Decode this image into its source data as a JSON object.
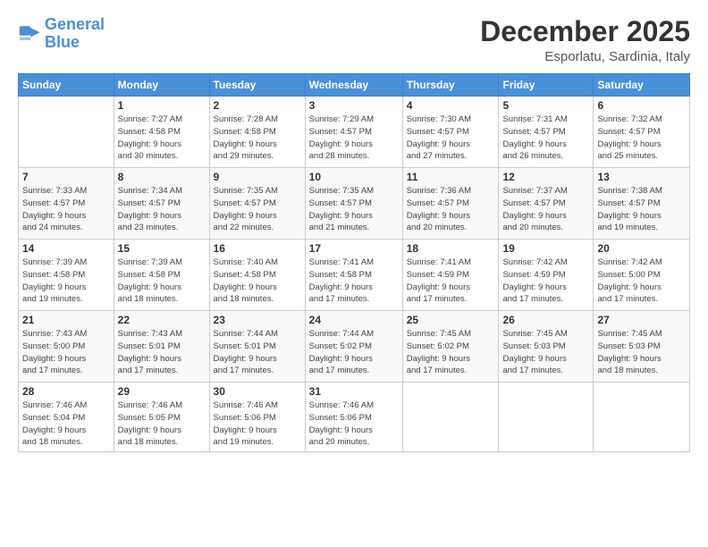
{
  "header": {
    "logo_line1": "General",
    "logo_line2": "Blue",
    "month": "December 2025",
    "location": "Esporlatu, Sardinia, Italy"
  },
  "weekdays": [
    "Sunday",
    "Monday",
    "Tuesday",
    "Wednesday",
    "Thursday",
    "Friday",
    "Saturday"
  ],
  "weeks": [
    [
      {
        "day": "",
        "info": ""
      },
      {
        "day": "1",
        "info": "Sunrise: 7:27 AM\nSunset: 4:58 PM\nDaylight: 9 hours\nand 30 minutes."
      },
      {
        "day": "2",
        "info": "Sunrise: 7:28 AM\nSunset: 4:58 PM\nDaylight: 9 hours\nand 29 minutes."
      },
      {
        "day": "3",
        "info": "Sunrise: 7:29 AM\nSunset: 4:57 PM\nDaylight: 9 hours\nand 28 minutes."
      },
      {
        "day": "4",
        "info": "Sunrise: 7:30 AM\nSunset: 4:57 PM\nDaylight: 9 hours\nand 27 minutes."
      },
      {
        "day": "5",
        "info": "Sunrise: 7:31 AM\nSunset: 4:57 PM\nDaylight: 9 hours\nand 26 minutes."
      },
      {
        "day": "6",
        "info": "Sunrise: 7:32 AM\nSunset: 4:57 PM\nDaylight: 9 hours\nand 25 minutes."
      }
    ],
    [
      {
        "day": "7",
        "info": "Sunrise: 7:33 AM\nSunset: 4:57 PM\nDaylight: 9 hours\nand 24 minutes."
      },
      {
        "day": "8",
        "info": "Sunrise: 7:34 AM\nSunset: 4:57 PM\nDaylight: 9 hours\nand 23 minutes."
      },
      {
        "day": "9",
        "info": "Sunrise: 7:35 AM\nSunset: 4:57 PM\nDaylight: 9 hours\nand 22 minutes."
      },
      {
        "day": "10",
        "info": "Sunrise: 7:35 AM\nSunset: 4:57 PM\nDaylight: 9 hours\nand 21 minutes."
      },
      {
        "day": "11",
        "info": "Sunrise: 7:36 AM\nSunset: 4:57 PM\nDaylight: 9 hours\nand 20 minutes."
      },
      {
        "day": "12",
        "info": "Sunrise: 7:37 AM\nSunset: 4:57 PM\nDaylight: 9 hours\nand 20 minutes."
      },
      {
        "day": "13",
        "info": "Sunrise: 7:38 AM\nSunset: 4:57 PM\nDaylight: 9 hours\nand 19 minutes."
      }
    ],
    [
      {
        "day": "14",
        "info": "Sunrise: 7:39 AM\nSunset: 4:58 PM\nDaylight: 9 hours\nand 19 minutes."
      },
      {
        "day": "15",
        "info": "Sunrise: 7:39 AM\nSunset: 4:58 PM\nDaylight: 9 hours\nand 18 minutes."
      },
      {
        "day": "16",
        "info": "Sunrise: 7:40 AM\nSunset: 4:58 PM\nDaylight: 9 hours\nand 18 minutes."
      },
      {
        "day": "17",
        "info": "Sunrise: 7:41 AM\nSunset: 4:58 PM\nDaylight: 9 hours\nand 17 minutes."
      },
      {
        "day": "18",
        "info": "Sunrise: 7:41 AM\nSunset: 4:59 PM\nDaylight: 9 hours\nand 17 minutes."
      },
      {
        "day": "19",
        "info": "Sunrise: 7:42 AM\nSunset: 4:59 PM\nDaylight: 9 hours\nand 17 minutes."
      },
      {
        "day": "20",
        "info": "Sunrise: 7:42 AM\nSunset: 5:00 PM\nDaylight: 9 hours\nand 17 minutes."
      }
    ],
    [
      {
        "day": "21",
        "info": "Sunrise: 7:43 AM\nSunset: 5:00 PM\nDaylight: 9 hours\nand 17 minutes."
      },
      {
        "day": "22",
        "info": "Sunrise: 7:43 AM\nSunset: 5:01 PM\nDaylight: 9 hours\nand 17 minutes."
      },
      {
        "day": "23",
        "info": "Sunrise: 7:44 AM\nSunset: 5:01 PM\nDaylight: 9 hours\nand 17 minutes."
      },
      {
        "day": "24",
        "info": "Sunrise: 7:44 AM\nSunset: 5:02 PM\nDaylight: 9 hours\nand 17 minutes."
      },
      {
        "day": "25",
        "info": "Sunrise: 7:45 AM\nSunset: 5:02 PM\nDaylight: 9 hours\nand 17 minutes."
      },
      {
        "day": "26",
        "info": "Sunrise: 7:45 AM\nSunset: 5:03 PM\nDaylight: 9 hours\nand 17 minutes."
      },
      {
        "day": "27",
        "info": "Sunrise: 7:45 AM\nSunset: 5:03 PM\nDaylight: 9 hours\nand 18 minutes."
      }
    ],
    [
      {
        "day": "28",
        "info": "Sunrise: 7:46 AM\nSunset: 5:04 PM\nDaylight: 9 hours\nand 18 minutes."
      },
      {
        "day": "29",
        "info": "Sunrise: 7:46 AM\nSunset: 5:05 PM\nDaylight: 9 hours\nand 18 minutes."
      },
      {
        "day": "30",
        "info": "Sunrise: 7:46 AM\nSunset: 5:06 PM\nDaylight: 9 hours\nand 19 minutes."
      },
      {
        "day": "31",
        "info": "Sunrise: 7:46 AM\nSunset: 5:06 PM\nDaylight: 9 hours\nand 20 minutes."
      },
      {
        "day": "",
        "info": ""
      },
      {
        "day": "",
        "info": ""
      },
      {
        "day": "",
        "info": ""
      }
    ]
  ]
}
